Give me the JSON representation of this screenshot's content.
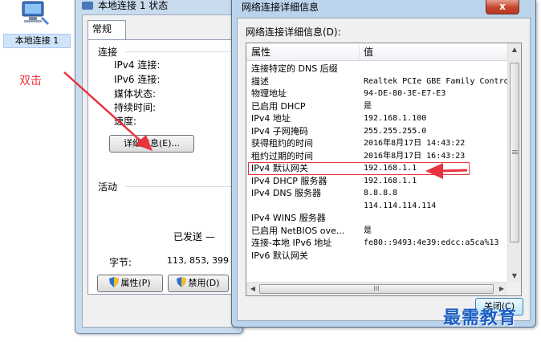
{
  "desktop": {
    "icon_label": "本地连接 1",
    "annotation": "双击"
  },
  "status_window": {
    "title": "本地连接 1 状态",
    "tab": "常规",
    "connection_group": "连接",
    "rows": [
      "IPv4 连接:",
      "IPv6 连接:",
      "媒体状态:",
      "持续时间:",
      "速度:"
    ],
    "details_button": "详细信息(E)...",
    "activity_group": "活动",
    "sent_label": "已发送 —",
    "bytes_label": "字节:",
    "bytes_value": "113, 853, 399",
    "properties_button": "属性(P)",
    "disable_button": "禁用(D)"
  },
  "details_window": {
    "title": "网络连接详细信息",
    "close_glyph": "x",
    "list_caption": "网络连接详细信息(D):",
    "columns": [
      "属性",
      "值"
    ],
    "rows": [
      {
        "prop": "连接特定的 DNS 后缀",
        "val": ""
      },
      {
        "prop": "描述",
        "val": "Realtek PCIe GBE Family Contro"
      },
      {
        "prop": "物理地址",
        "val": "94-DE-80-3E-E7-E3"
      },
      {
        "prop": "已启用 DHCP",
        "val": "是"
      },
      {
        "prop": "IPv4 地址",
        "val": "192.168.1.100"
      },
      {
        "prop": "IPv4 子网掩码",
        "val": "255.255.255.0"
      },
      {
        "prop": "获得租约的时间",
        "val": "2016年8月17日 14:43:22"
      },
      {
        "prop": "租约过期的时间",
        "val": "2016年8月17日 16:43:23"
      },
      {
        "prop": "IPv4 默认网关",
        "val": "192.168.1.1"
      },
      {
        "prop": "IPv4 DHCP 服务器",
        "val": "192.168.1.1"
      },
      {
        "prop": "IPv4 DNS 服务器",
        "val": "8.8.8.8"
      },
      {
        "prop": "",
        "val": "114.114.114.114"
      },
      {
        "prop": "IPv4 WINS 服务器",
        "val": ""
      },
      {
        "prop": "已启用 NetBIOS ove...",
        "val": "是"
      },
      {
        "prop": "连接-本地 IPv6 地址",
        "val": "fe80::9493:4e39:edcc:a5ca%13"
      },
      {
        "prop": "IPv6 默认网关",
        "val": ""
      }
    ],
    "highlighted_row": "IPv4 默认网关",
    "hscroll_grip": "III",
    "close_button": "关闭(C)"
  },
  "watermark": "最需教育",
  "colors": {
    "annotation_red": "#e8343e",
    "title_blue": "#bcd3ec",
    "watermark_blue": "#1c5fc4"
  }
}
